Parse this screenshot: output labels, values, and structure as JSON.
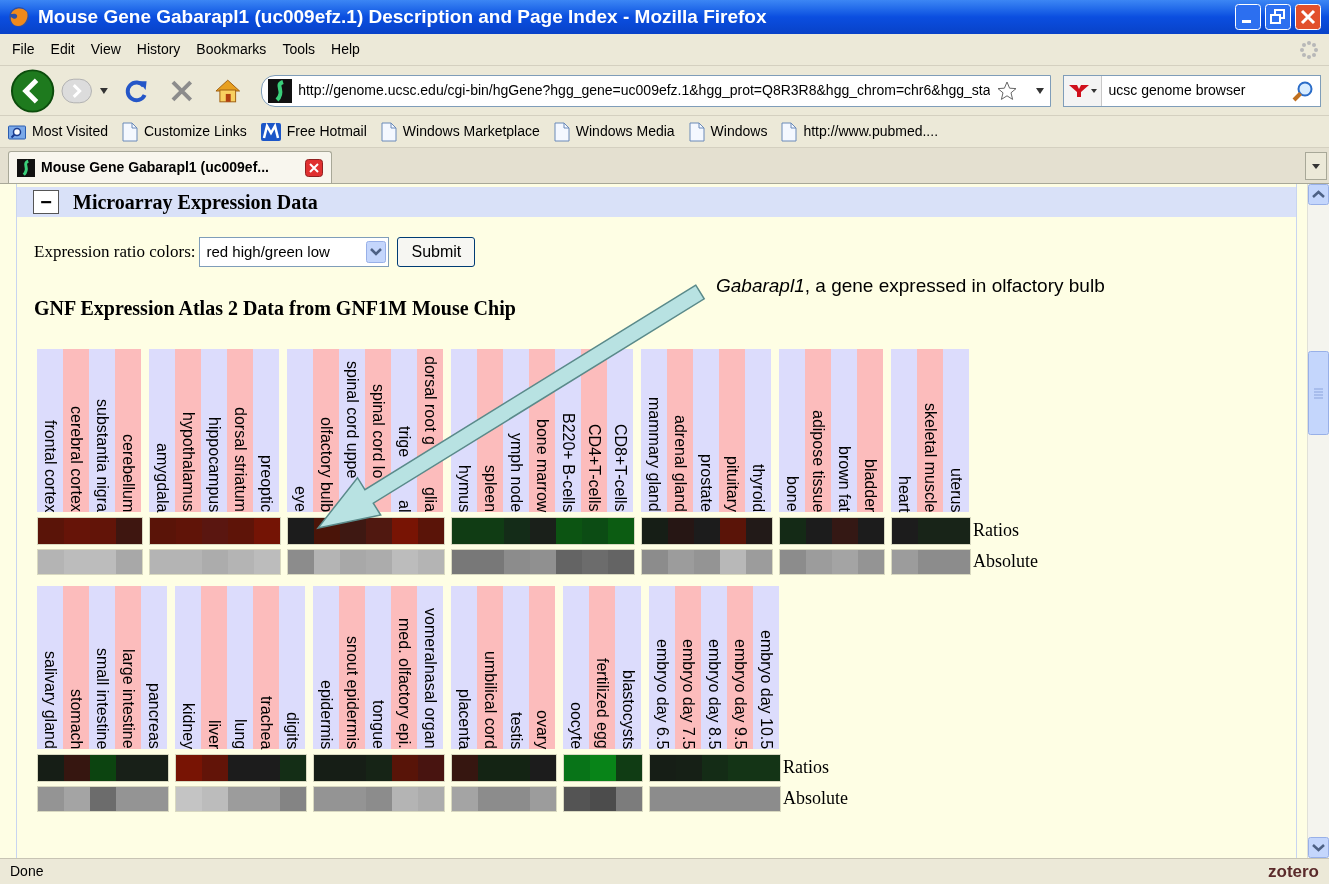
{
  "window": {
    "title": "Mouse Gene Gabarapl1 (uc009efz.1) Description and Page Index - Mozilla Firefox"
  },
  "menu": [
    "File",
    "Edit",
    "View",
    "History",
    "Bookmarks",
    "Tools",
    "Help"
  ],
  "toolbar": {
    "url": "http://genome.ucsc.edu/cgi-bin/hgGene?hgg_gene=uc009efz.1&hgg_prot=Q8R3R8&hgg_chrom=chr6&hgg_sta",
    "search": "ucsc genome browser"
  },
  "bookmarks": [
    {
      "label": "Most Visited",
      "kind": "smart"
    },
    {
      "label": "Customize Links",
      "kind": "page"
    },
    {
      "label": "Free Hotmail",
      "kind": "hotmail"
    },
    {
      "label": "Windows Marketplace",
      "kind": "page"
    },
    {
      "label": "Windows Media",
      "kind": "page"
    },
    {
      "label": "Windows",
      "kind": "page"
    },
    {
      "label": "http://www.pubmed....",
      "kind": "page"
    }
  ],
  "tabs": [
    {
      "label": "Mouse Gene Gabarapl1 (uc009ef...",
      "selected": true
    }
  ],
  "section": {
    "toggle": "−",
    "title": "Microarray Expression Data"
  },
  "color_control": {
    "label": "Expression ratio colors:",
    "value": "red high/green low",
    "button": "Submit"
  },
  "heading": "GNF Expression Atlas 2 Data from GNF1M Mouse Chip",
  "annotation": "*Gabarapl1*, a gene expressed in olfactory bulb",
  "heatmaps": [
    {
      "row_labels": [
        "Ratios",
        "Absolute"
      ],
      "groups": [
        [
          {
            "kind": "whole",
            "name": "frontal cortex",
            "ratio": {
              "color": "#5a1408"
            },
            "absolute": {
              "color": "#b4b4b4"
            }
          },
          {
            "kind": "whole",
            "name": "cerebral cortex",
            "ratio": {
              "color": "#661408"
            },
            "absolute": {
              "color": "#bcbcbc"
            }
          },
          {
            "kind": "whole",
            "name": "substantia nigra",
            "ratio": {
              "color": "#621408"
            },
            "absolute": {
              "color": "#bcbcbc"
            }
          },
          {
            "kind": "whole",
            "name": "cerebellum",
            "ratio": {
              "color": "#3e1610"
            },
            "absolute": {
              "color": "#a8a8a8"
            }
          }
        ],
        [
          {
            "kind": "whole",
            "name": "amygdala",
            "ratio": {
              "color": "#5a1408"
            },
            "absolute": {
              "color": "#b4b4b4"
            }
          },
          {
            "kind": "whole",
            "name": "hypothalamus",
            "ratio": {
              "color": "#601408"
            },
            "absolute": {
              "color": "#b4b4b4"
            }
          },
          {
            "kind": "whole",
            "name": "hippocampus",
            "ratio": {
              "color": "#5a1610"
            },
            "absolute": {
              "color": "#acacac"
            }
          },
          {
            "kind": "whole",
            "name": "dorsal striatum",
            "ratio": {
              "color": "#5e1408"
            },
            "absolute": {
              "color": "#b4b4b4"
            }
          },
          {
            "kind": "whole",
            "name": "preoptic",
            "ratio": {
              "color": "#741405"
            },
            "absolute": {
              "color": "#bcbcbc"
            }
          }
        ],
        [
          {
            "kind": "whole",
            "name": "eye",
            "ratio": {
              "color": "#1c1c1c"
            },
            "absolute": {
              "color": "#8c8c8c"
            }
          },
          {
            "kind": "whole",
            "name": "olfactory bulb",
            "ratio": {
              "color": "#4a1408"
            },
            "absolute": {
              "color": "#b4b4b4"
            }
          },
          {
            "kind": "clipped",
            "name": "spinal cord uppe",
            "ratio": {
              "color": "#3e1812"
            },
            "absolute": {
              "color": "#a8a8a8"
            }
          },
          {
            "kind": "clipped",
            "name": "spinal cord lo",
            "ratio": {
              "color": "#501810"
            },
            "absolute": {
              "color": "#acacac"
            }
          },
          {
            "kind": "split",
            "parts": [
              "trige",
              "al"
            ],
            "ratio": {
              "color": "#781404"
            },
            "absolute": {
              "color": "#bcbcbc"
            }
          },
          {
            "kind": "split",
            "parts": [
              "dorsal root g",
              "glia"
            ],
            "ratio": {
              "color": "#5a1408"
            },
            "absolute": {
              "color": "#b4b4b4"
            }
          }
        ],
        [
          {
            "kind": "whole",
            "name": "hymus",
            "ratio": {
              "color": "#103c14"
            },
            "absolute": {
              "color": "#787878"
            }
          },
          {
            "kind": "whole",
            "name": "spleen",
            "ratio": {
              "color": "#103c14"
            },
            "absolute": {
              "color": "#787878"
            }
          },
          {
            "kind": "whole",
            "name": "ymph node",
            "ratio": {
              "color": "#142c18"
            },
            "absolute": {
              "color": "#8c8c8c"
            }
          },
          {
            "kind": "whole",
            "name": "bone marrow",
            "ratio": {
              "color": "#1a201a"
            },
            "absolute": {
              "color": "#909090"
            }
          },
          {
            "kind": "whole",
            "name": "B220+ B-cells",
            "ratio": {
              "color": "#0c5412"
            },
            "absolute": {
              "color": "#646464"
            }
          },
          {
            "kind": "whole",
            "name": "CD4+T-cells",
            "ratio": {
              "color": "#0c4c14"
            },
            "absolute": {
              "color": "#6c6c6c"
            }
          },
          {
            "kind": "whole",
            "name": "CD8+T-cells",
            "ratio": {
              "color": "#0c5c12"
            },
            "absolute": {
              "color": "#646464"
            }
          }
        ],
        [
          {
            "kind": "whole",
            "name": "mammary gland",
            "ratio": {
              "color": "#161e16"
            },
            "absolute": {
              "color": "#8c8c8c"
            }
          },
          {
            "kind": "whole",
            "name": "adrenal gland",
            "ratio": {
              "color": "#261614"
            },
            "absolute": {
              "color": "#9c9c9c"
            }
          },
          {
            "kind": "whole",
            "name": "prostate",
            "ratio": {
              "color": "#1c1c1c"
            },
            "absolute": {
              "color": "#949494"
            }
          },
          {
            "kind": "whole",
            "name": "pituitary",
            "ratio": {
              "color": "#5a1408"
            },
            "absolute": {
              "color": "#b8b8b8"
            }
          },
          {
            "kind": "whole",
            "name": "thyroid",
            "ratio": {
              "color": "#221a18"
            },
            "absolute": {
              "color": "#9c9c9c"
            }
          }
        ],
        [
          {
            "kind": "whole",
            "name": "bone",
            "ratio": {
              "color": "#142a16"
            },
            "absolute": {
              "color": "#8c8c8c"
            }
          },
          {
            "kind": "whole",
            "name": "adipose tissue",
            "ratio": {
              "color": "#1c1c1c"
            },
            "absolute": {
              "color": "#9c9c9c"
            }
          },
          {
            "kind": "whole",
            "name": "brown fat",
            "ratio": {
              "color": "#341814"
            },
            "absolute": {
              "color": "#a4a4a4"
            }
          },
          {
            "kind": "whole",
            "name": "bladder",
            "ratio": {
              "color": "#1c1c1c"
            },
            "absolute": {
              "color": "#949494"
            }
          }
        ],
        [
          {
            "kind": "whole",
            "name": "heart",
            "ratio": {
              "color": "#1c1c1c"
            },
            "absolute": {
              "color": "#9c9c9c"
            }
          },
          {
            "kind": "whole",
            "name": "skeletal muscle",
            "ratio": {
              "color": "#182418"
            },
            "absolute": {
              "color": "#8c8c8c"
            }
          },
          {
            "kind": "whole",
            "name": "uterus",
            "ratio": {
              "color": "#182418"
            },
            "absolute": {
              "color": "#8c8c8c"
            }
          }
        ]
      ]
    },
    {
      "row_labels": [
        "Ratios",
        "Absolute"
      ],
      "groups": [
        [
          {
            "kind": "whole",
            "name": "salivary gland",
            "ratio": {
              "color": "#161e16"
            },
            "absolute": {
              "color": "#949494"
            }
          },
          {
            "kind": "whole",
            "name": "stomach",
            "ratio": {
              "color": "#361610"
            },
            "absolute": {
              "color": "#a4a4a4"
            }
          },
          {
            "kind": "whole",
            "name": "small intestine",
            "ratio": {
              "color": "#0c4410"
            },
            "absolute": {
              "color": "#6c6c6c"
            }
          },
          {
            "kind": "whole",
            "name": "large intestine",
            "ratio": {
              "color": "#182018"
            },
            "absolute": {
              "color": "#949494"
            }
          },
          {
            "kind": "whole",
            "name": "pancreas",
            "ratio": {
              "color": "#182018"
            },
            "absolute": {
              "color": "#949494"
            }
          }
        ],
        [
          {
            "kind": "whole",
            "name": "kidney",
            "ratio": {
              "color": "#781404"
            },
            "absolute": {
              "color": "#c4c4c4"
            }
          },
          {
            "kind": "whole",
            "name": "liver",
            "ratio": {
              "color": "#621408"
            },
            "absolute": {
              "color": "#bcbcbc"
            }
          },
          {
            "kind": "whole",
            "name": "lung",
            "ratio": {
              "color": "#1c1c1c"
            },
            "absolute": {
              "color": "#9c9c9c"
            }
          },
          {
            "kind": "whole",
            "name": "trachea",
            "ratio": {
              "color": "#1c1c1c"
            },
            "absolute": {
              "color": "#9c9c9c"
            }
          },
          {
            "kind": "whole",
            "name": "digits",
            "ratio": {
              "color": "#142e16"
            },
            "absolute": {
              "color": "#848484"
            }
          }
        ],
        [
          {
            "kind": "whole",
            "name": "epidermis",
            "ratio": {
              "color": "#161e16"
            },
            "absolute": {
              "color": "#949494"
            }
          },
          {
            "kind": "whole",
            "name": "snout epidermis",
            "ratio": {
              "color": "#161e16"
            },
            "absolute": {
              "color": "#949494"
            }
          },
          {
            "kind": "whole",
            "name": "tongue",
            "ratio": {
              "color": "#162416"
            },
            "absolute": {
              "color": "#8c8c8c"
            }
          },
          {
            "kind": "whole",
            "name": "med. olfactory epi.",
            "ratio": {
              "color": "#581408"
            },
            "absolute": {
              "color": "#b4b4b4"
            }
          },
          {
            "kind": "whole",
            "name": "vomeralnasal organ",
            "ratio": {
              "color": "#481410"
            },
            "absolute": {
              "color": "#acacac"
            }
          }
        ],
        [
          {
            "kind": "whole",
            "name": "placenta",
            "ratio": {
              "color": "#361610"
            },
            "absolute": {
              "color": "#a4a4a4"
            }
          },
          {
            "kind": "whole",
            "name": "umbilical cord",
            "ratio": {
              "color": "#142414"
            },
            "absolute": {
              "color": "#8c8c8c"
            }
          },
          {
            "kind": "whole",
            "name": "testis",
            "ratio": {
              "color": "#142414"
            },
            "absolute": {
              "color": "#8c8c8c"
            }
          },
          {
            "kind": "whole",
            "name": "ovary",
            "ratio": {
              "color": "#1c1c1c"
            },
            "absolute": {
              "color": "#9c9c9c"
            }
          }
        ],
        [
          {
            "kind": "whole",
            "name": "oocyte",
            "ratio": {
              "color": "#087418"
            },
            "absolute": {
              "color": "#545454"
            }
          },
          {
            "kind": "whole",
            "name": "fertilized egg",
            "ratio": {
              "color": "#088418"
            },
            "absolute": {
              "color": "#4c4c4c"
            }
          },
          {
            "kind": "whole",
            "name": "blastocysts",
            "ratio": {
              "color": "#103c14"
            },
            "absolute": {
              "color": "#7c7c7c"
            }
          }
        ],
        [
          {
            "kind": "whole",
            "name": "embryo day 6.5",
            "ratio": {
              "color": "#161e16"
            },
            "absolute": {
              "color": "#8c8c8c"
            }
          },
          {
            "kind": "whole",
            "name": "embryo day 7.5",
            "ratio": {
              "color": "#162016"
            },
            "absolute": {
              "color": "#8c8c8c"
            }
          },
          {
            "kind": "whole",
            "name": "embryo day 8.5",
            "ratio": {
              "color": "#142c16"
            },
            "absolute": {
              "color": "#8c8c8c"
            }
          },
          {
            "kind": "whole",
            "name": "embryo day 9.5",
            "ratio": {
              "color": "#143416"
            },
            "absolute": {
              "color": "#8c8c8c"
            }
          },
          {
            "kind": "whole",
            "name": "embryo day 10.5",
            "ratio": {
              "color": "#143416"
            },
            "absolute": {
              "color": "#8c8c8c"
            }
          }
        ]
      ]
    }
  ],
  "status": {
    "text": "Done",
    "addon": "zotero"
  }
}
